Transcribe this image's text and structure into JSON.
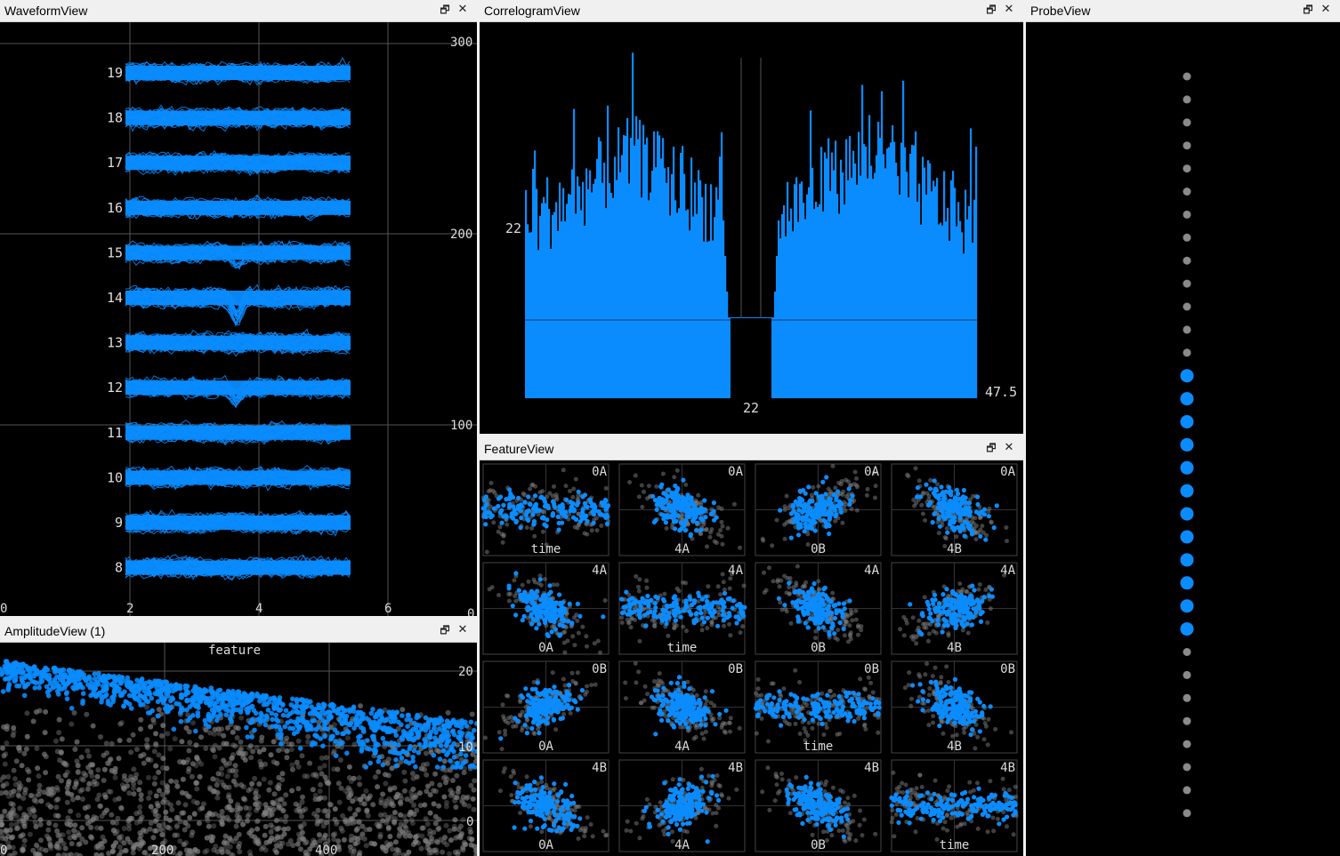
{
  "colors": {
    "accent": "#0a8cff",
    "gray": "#808080",
    "bg": "#000000",
    "grid": "#555555",
    "titlebar": "#f0f0f0"
  },
  "icons": {
    "float": "float-window-icon",
    "close": "close-icon"
  },
  "glyphs": {
    "float": "🗗",
    "close": "✕"
  },
  "waveform": {
    "title": "WaveformView",
    "channel_labels": [
      "19",
      "18",
      "17",
      "16",
      "15",
      "14",
      "13",
      "12",
      "11",
      "10",
      "9",
      "8"
    ],
    "x_ticks": [
      "0",
      "2",
      "4",
      "6"
    ],
    "y_ticks": [
      "300",
      "200",
      "100",
      "0"
    ]
  },
  "correlogram": {
    "title": "CorrelogramView",
    "y_label": "22",
    "x_label": "22",
    "right_label": "47.5"
  },
  "probe": {
    "title": "ProbeView",
    "channels_total": 33,
    "selected_range": [
      13,
      24
    ]
  },
  "amplitude": {
    "title": "AmplitudeView (1)",
    "label": "feature",
    "x_ticks": [
      "0",
      "200",
      "400"
    ],
    "y_ticks": [
      "20",
      "10",
      "0"
    ]
  },
  "feature": {
    "title": "FeatureView",
    "grid": [
      [
        {
          "top": "0A",
          "bottom": "time"
        },
        {
          "top": "0A",
          "bottom": "4A"
        },
        {
          "top": "0A",
          "bottom": "0B"
        },
        {
          "top": "0A",
          "bottom": "4B"
        }
      ],
      [
        {
          "top": "4A",
          "bottom": "0A"
        },
        {
          "top": "4A",
          "bottom": "time"
        },
        {
          "top": "4A",
          "bottom": "0B"
        },
        {
          "top": "4A",
          "bottom": "4B"
        }
      ],
      [
        {
          "top": "0B",
          "bottom": "0A"
        },
        {
          "top": "0B",
          "bottom": "4A"
        },
        {
          "top": "0B",
          "bottom": "time"
        },
        {
          "top": "0B",
          "bottom": "4B"
        }
      ],
      [
        {
          "top": "4B",
          "bottom": "0A"
        },
        {
          "top": "4B",
          "bottom": "4A"
        },
        {
          "top": "4B",
          "bottom": "0B"
        },
        {
          "top": "4B",
          "bottom": "time"
        }
      ]
    ]
  }
}
